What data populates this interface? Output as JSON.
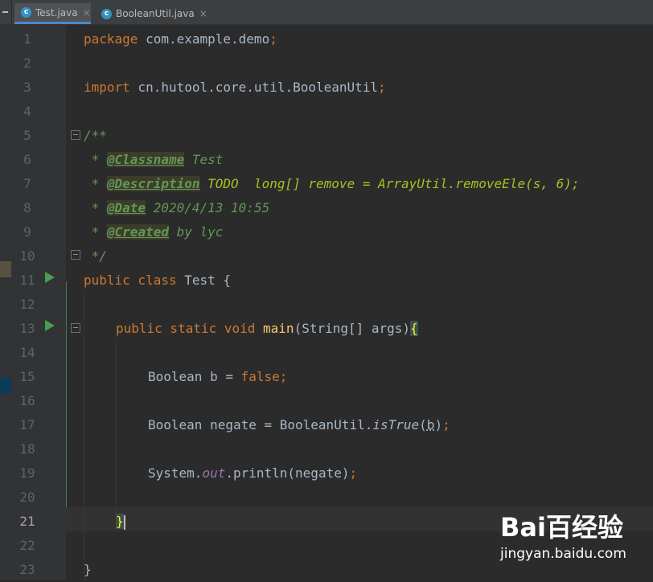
{
  "tabs": [
    {
      "label": "Test.java",
      "icon": "c",
      "active": true
    },
    {
      "label": "BooleanUtil.java",
      "icon": "c",
      "active": false
    }
  ],
  "tab_close_glyph": "×",
  "line_numbers": [
    "1",
    "2",
    "3",
    "4",
    "5",
    "6",
    "7",
    "8",
    "9",
    "10",
    "11",
    "12",
    "13",
    "14",
    "15",
    "16",
    "17",
    "18",
    "19",
    "20",
    "21",
    "22",
    "23"
  ],
  "code": {
    "l1": {
      "kw": "package",
      "pkg": " com.example.demo",
      "semi": ";"
    },
    "l3": {
      "kw": "import",
      "pkg": " cn.hutool.core.util.BooleanUtil",
      "semi": ";"
    },
    "l5": {
      "text": "/**"
    },
    "l6": {
      "star": " * ",
      "tag": "@Classname",
      "rest": " Test"
    },
    "l7": {
      "star": " * ",
      "tag": "@Description",
      "todo": " TODO  long[] remove = ArrayUtil.removeEle(s, 6);"
    },
    "l8": {
      "star": " * ",
      "tag": "@Date",
      "rest": " 2020/4/13 10:55"
    },
    "l9": {
      "star": " * ",
      "tag": "@Created",
      "rest": " by lyc"
    },
    "l10": {
      "text": " */"
    },
    "l11": {
      "kw": "public class",
      "rest": " Test {"
    },
    "l13": {
      "kw": "public static void",
      "method": " main",
      "args": "(String[] args)",
      "brace": "{"
    },
    "l15": {
      "type": "Boolean b = ",
      "val": "false",
      "semi": ";"
    },
    "l17": {
      "type": "Boolean negate = BooleanUtil.",
      "call": "isTrue",
      "open": "(",
      "param": "b",
      "close": ")",
      "semi": ";"
    },
    "l19": {
      "sys": "System.",
      "field": "out",
      "rest": ".println(negate)",
      "semi": ";"
    },
    "l21": {
      "brace": "}"
    },
    "l23": {
      "brace": "}"
    }
  },
  "watermark": {
    "logo": "Bai百经验",
    "url": "jingyan.baidu.com"
  },
  "colors": {
    "keyword": "#cc7832",
    "doc": "#629755",
    "todo": "#a8c023",
    "method": "#ffc66d",
    "field": "#9876aa",
    "text": "#a9b7c6",
    "run": "#499c54"
  }
}
